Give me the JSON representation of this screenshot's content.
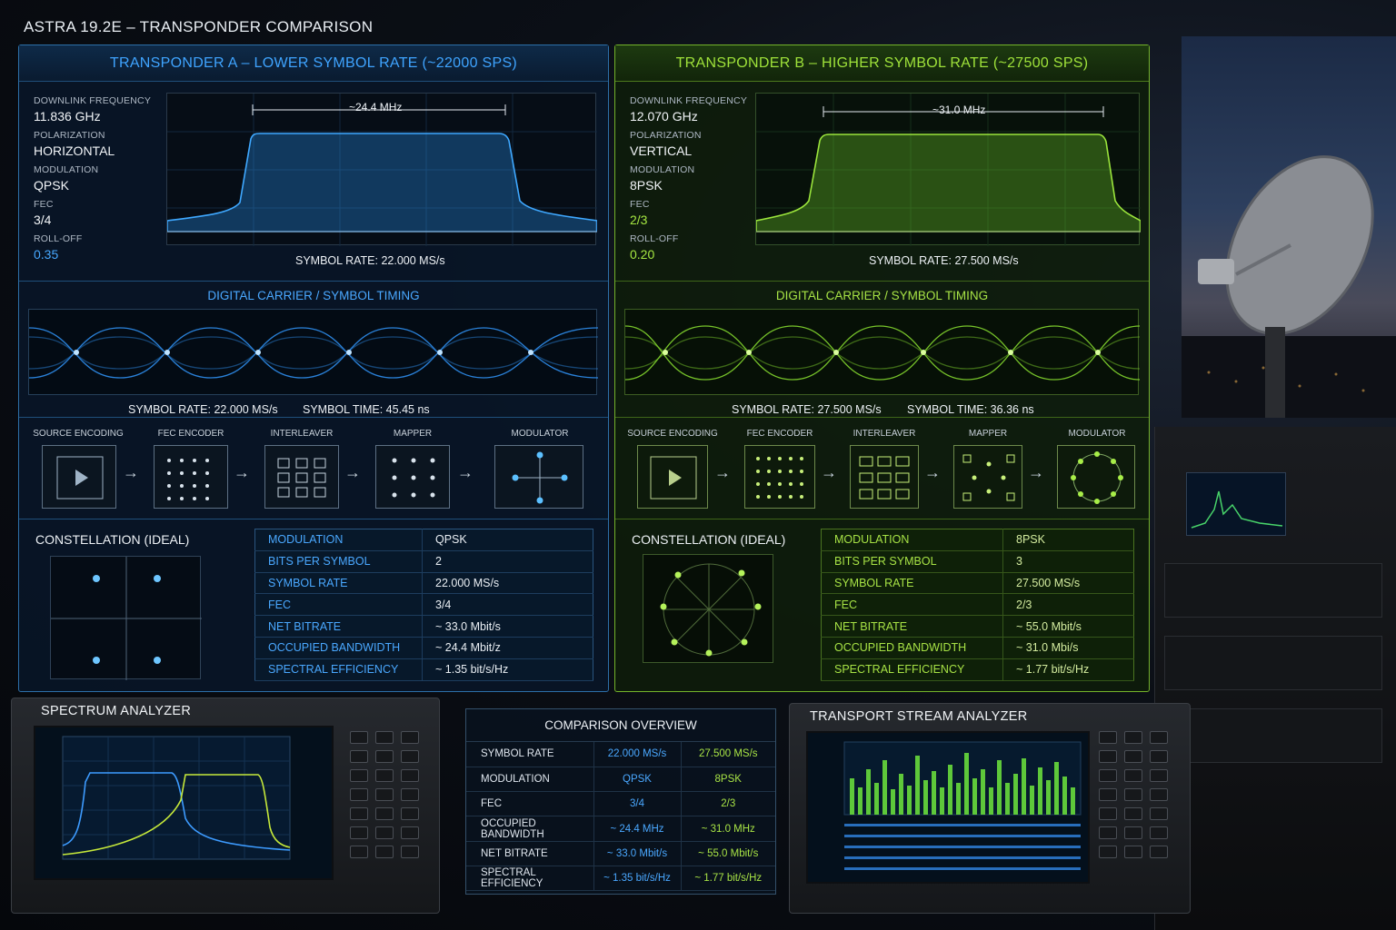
{
  "page_title": "ASTRA 19.2E – TRANSPONDER COMPARISON",
  "colors": {
    "a_accent": "#3fa4ff",
    "b_accent": "#9fe23a"
  },
  "transponder_a": {
    "title": "TRANSPONDER A – LOWER SYMBOL RATE (~22000 SPS)",
    "specs": [
      {
        "label": "DOWNLINK FREQUENCY",
        "value": "11.836 GHz"
      },
      {
        "label": "POLARIZATION",
        "value": "HORIZONTAL"
      },
      {
        "label": "MODULATION",
        "value": "QPSK"
      },
      {
        "label": "FEC",
        "value": "3/4"
      },
      {
        "label": "ROLL-OFF",
        "value": "0.35"
      }
    ],
    "bandwidth_label": "~24.4 MHz",
    "spectrum_caption": "SYMBOL RATE:  22.000 MS/s",
    "timing_title": "DIGITAL CARRIER / SYMBOL TIMING",
    "timing_rate": "SYMBOL RATE:  22.000 MS/s",
    "timing_time": "SYMBOL TIME:  45.45 ns",
    "chain": [
      "SOURCE ENCODING",
      "FEC ENCODER",
      "INTERLEAVER",
      "MAPPER",
      "MODULATOR"
    ],
    "constellation_title": "CONSTELLATION (IDEAL)",
    "params": [
      {
        "k": "MODULATION",
        "v": "QPSK"
      },
      {
        "k": "BITS PER SYMBOL",
        "v": "2"
      },
      {
        "k": "SYMBOL RATE",
        "v": "22.000 MS/s"
      },
      {
        "k": "FEC",
        "v": "3/4"
      },
      {
        "k": "NET BITRATE",
        "v": "~ 33.0 Mbit/s"
      },
      {
        "k": "OCCUPIED BANDWIDTH",
        "v": "~ 24.4 Mbit/z"
      },
      {
        "k": "SPECTRAL EFFICIENCY",
        "v": "~ 1.35 bit/s/Hz"
      }
    ]
  },
  "transponder_b": {
    "title": "TRANSPONDER B – HIGHER SYMBOL RATE (~27500 SPS)",
    "specs": [
      {
        "label": "DOWNLINK FREQUENCY",
        "value": "12.070 GHz"
      },
      {
        "label": "POLARIZATION",
        "value": "VERTICAL"
      },
      {
        "label": "MODULATION",
        "value": "8PSK"
      },
      {
        "label": "FEC",
        "value": "2/3"
      },
      {
        "label": "ROLL-OFF",
        "value": "0.20"
      }
    ],
    "bandwidth_label": "~31.0 MHz",
    "spectrum_caption": "SYMBOL RATE:  27.500 MS/s",
    "timing_title": "DIGITAL CARRIER / SYMBOL TIMING",
    "timing_rate": "SYMBOL RATE:  27.500 MS/s",
    "timing_time": "SYMBOL TIME:  36.36 ns",
    "chain": [
      "SOURCE ENCODING",
      "FEC ENCODER",
      "INTERLEAVER",
      "MAPPER",
      "MODULATOR"
    ],
    "constellation_title": "CONSTELLATION (IDEAL)",
    "params": [
      {
        "k": "MODULATION",
        "v": "8PSK"
      },
      {
        "k": "BITS PER SYMBOL",
        "v": "3"
      },
      {
        "k": "SYMBOL RATE",
        "v": "27.500 MS/s"
      },
      {
        "k": "FEC",
        "v": "2/3"
      },
      {
        "k": "NET BITRATE",
        "v": "~ 55.0 Mbit/s"
      },
      {
        "k": "OCCUPIED BANDWIDTH",
        "v": "~ 31.0 Mbi/s"
      },
      {
        "k": "SPECTRAL EFFICIENCY",
        "v": "~ 1.77 bit/s/Hz"
      }
    ]
  },
  "spectrum_analyzer": {
    "title": "SPECTRUM ANALYZER"
  },
  "transport_analyzer": {
    "title": "TRANSPORT STREAM ANALYZER"
  },
  "comparison": {
    "title": "COMPARISON OVERVIEW",
    "rows": [
      {
        "k": "SYMBOL RATE",
        "a": "22.000 MS/s",
        "b": "27.500 MS/s"
      },
      {
        "k": "MODULATION",
        "a": "QPSK",
        "b": "8PSK"
      },
      {
        "k": "FEC",
        "a": "3/4",
        "b": "2/3"
      },
      {
        "k": "OCCUPIED BANDWIDTH",
        "a": "~ 24.4 MHz",
        "b": "~ 31.0 MHz"
      },
      {
        "k": "NET BITRATE",
        "a": "~ 33.0 Mbit/s",
        "b": "~ 55.0 Mbit/s"
      },
      {
        "k": "SPECTRAL EFFICIENCY",
        "a": "~ 1.35 bit/s/Hz",
        "b": "~ 1.77 bit/s/Hz"
      }
    ]
  }
}
